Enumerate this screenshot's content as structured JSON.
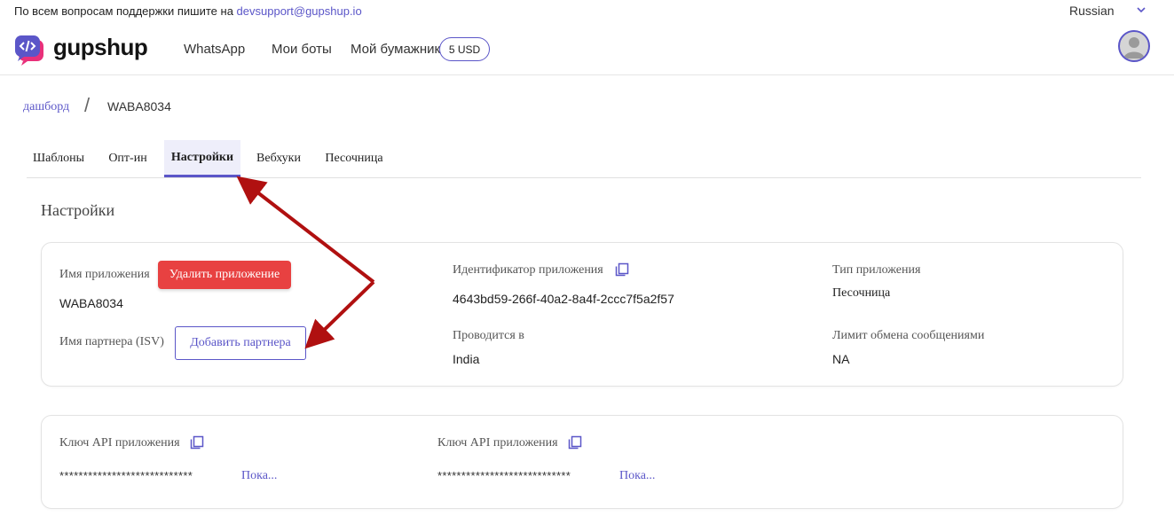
{
  "topbar": {
    "support_text": "По всем вопросам поддержки пишите на",
    "support_email": "devsupport@gupshup.io",
    "language": "Russian"
  },
  "header": {
    "brand": "gupshup",
    "nav": [
      "WhatsApp",
      "Мои боты",
      "Мой бумажник"
    ],
    "wallet_balance": "5 USD"
  },
  "breadcrumb": {
    "link": "дашборд",
    "separator": "/",
    "current": "WABA8034"
  },
  "tabs": [
    {
      "label": "Шаблоны",
      "active": false
    },
    {
      "label": "Опт-ин",
      "active": false
    },
    {
      "label": "Настройки",
      "active": true
    },
    {
      "label": "Вебхуки",
      "active": false
    },
    {
      "label": "Песочница",
      "active": false
    }
  ],
  "section_title": "Настройки",
  "app_card": {
    "app_name_label": "Имя приложения",
    "delete_button": "Удалить приложение",
    "app_name_value": "WABA8034",
    "partner_label": "Имя партнера (ISV)",
    "add_partner_button": "Добавить партнера",
    "app_id_label": "Идентификатор приложения",
    "app_id_value": "4643bd59-266f-40a2-8a4f-2ccc7f5a2f57",
    "hosted_label": "Проводится в",
    "hosted_value": "India",
    "app_type_label": "Тип приложения",
    "app_type_value": "Песочница",
    "limit_label": "Лимит обмена сообщениями",
    "limit_value": "NA"
  },
  "api_card": {
    "keys": [
      {
        "label": "Ключ API приложения",
        "masked": "****************************",
        "show": "Пока..."
      },
      {
        "label": "Ключ API приложения",
        "masked": "****************************",
        "show": "Пока..."
      }
    ]
  },
  "colors": {
    "accent": "#5b56c8",
    "danger": "#e84141",
    "annotation_arrow": "#b01010",
    "logo_pink": "#e9307a"
  },
  "icons": [
    "chevron-down-icon",
    "gupshup-logo-icon",
    "user-avatar-icon",
    "copy-icon"
  ]
}
